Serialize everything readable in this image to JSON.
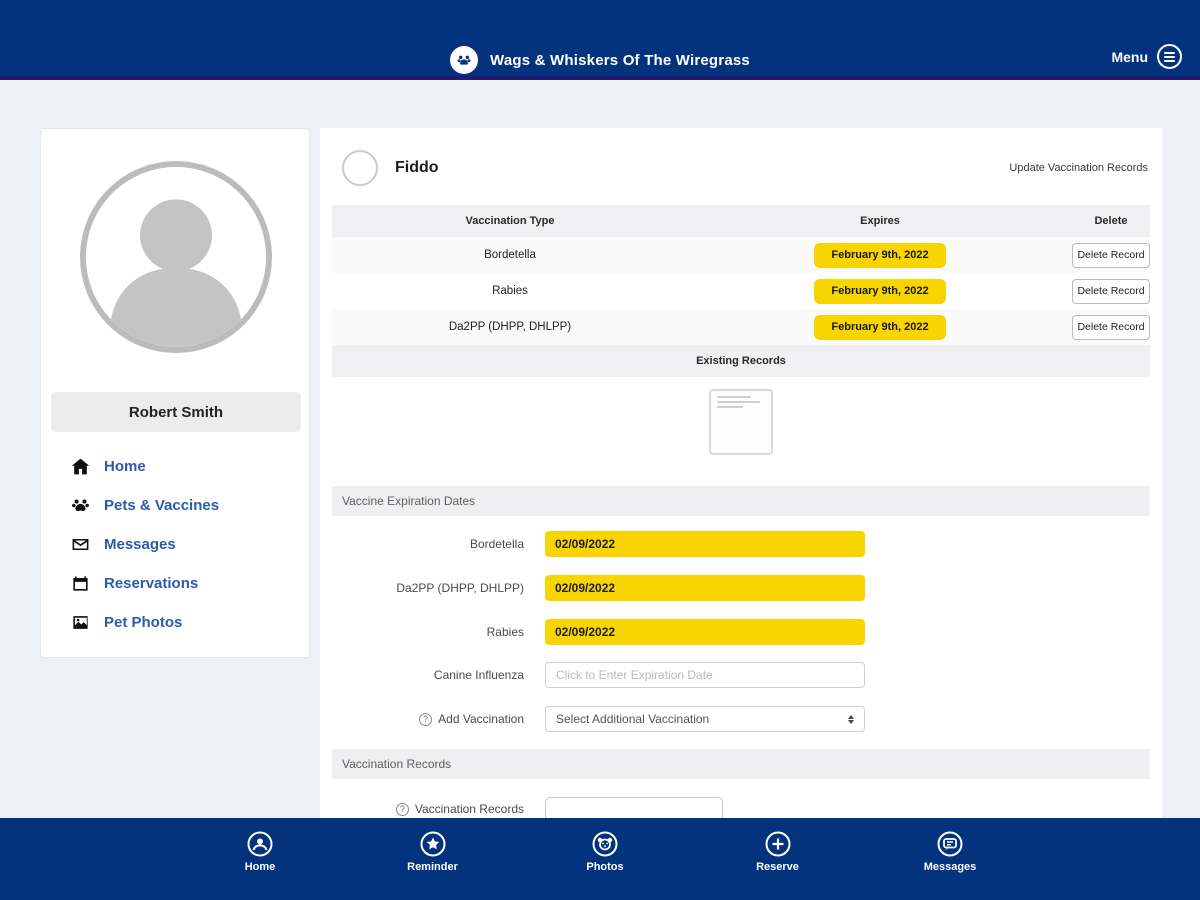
{
  "header": {
    "title": "Wags & Whiskers Of The Wiregrass",
    "menu_label": "Menu",
    "logo_icon": "paw-icon",
    "menu_icon": "hamburger-circle-icon"
  },
  "sidebar": {
    "user_name": "Robert Smith",
    "avatar_icon": "person-silhouette-icon",
    "items": [
      {
        "label": "Home",
        "icon": "home-icon"
      },
      {
        "label": "Pets & Vaccines",
        "icon": "paw-icon"
      },
      {
        "label": "Messages",
        "icon": "envelope-icon"
      },
      {
        "label": "Reservations",
        "icon": "calendar-icon"
      },
      {
        "label": "Pet Photos",
        "icon": "photo-icon"
      }
    ]
  },
  "pet": {
    "name": "Fiddo",
    "avatar_icon": "dog-photo-avatar",
    "update_link": "Update Vaccination Records"
  },
  "vaccine_table": {
    "columns": [
      "Vaccination Type",
      "Expires",
      "Delete"
    ],
    "rows": [
      {
        "type": "Bordetella",
        "expires": "February 9th, 2022",
        "delete_label": "Delete Record"
      },
      {
        "type": "Rabies",
        "expires": "February 9th, 2022",
        "delete_label": "Delete Record"
      },
      {
        "type": "Da2PP (DHPP, DHLPP)",
        "expires": "February 9th, 2022",
        "delete_label": "Delete Record"
      }
    ],
    "existing_records_label": "Existing Records",
    "thumbnail_icon": "document-thumbnail"
  },
  "expiration_form": {
    "section_title": "Vaccine Expiration Dates",
    "fields": [
      {
        "label": "Bordetella",
        "value": "02/09/2022"
      },
      {
        "label": "Da2PP (DHPP, DHLPP)",
        "value": "02/09/2022"
      },
      {
        "label": "Rabies",
        "value": "02/09/2022"
      },
      {
        "label": "Canine Influenza",
        "value": "",
        "placeholder": "Click to Enter Expiration Date"
      }
    ],
    "add_label": "Add Vaccination",
    "add_info_icon": "question-circle-icon",
    "select_value": "Select Additional Vaccination"
  },
  "records_section": {
    "section_title": "Vaccination Records",
    "field_label": "Vaccination Records",
    "info_icon": "question-circle-icon"
  },
  "bottom_nav": {
    "items": [
      {
        "label": "Home",
        "icon": "person-circle-icon"
      },
      {
        "label": "Reminder",
        "icon": "star-circle-icon"
      },
      {
        "label": "Photos",
        "icon": "dog-face-circle-icon"
      },
      {
        "label": "Reserve",
        "icon": "plus-circle-icon"
      },
      {
        "label": "Messages",
        "icon": "chat-circle-icon"
      }
    ]
  },
  "colors": {
    "primary_blue": "#04337e",
    "navy_divider": "#221a6e",
    "accent_yellow": "#f8d400",
    "link_blue": "#2b5caa",
    "page_bg": "#edf0f4"
  }
}
